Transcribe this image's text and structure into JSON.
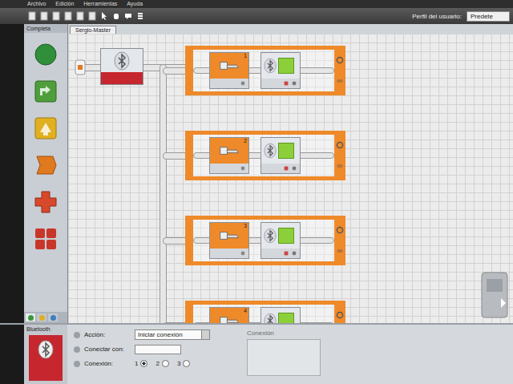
{
  "menu": [
    "Archivo",
    "Edición",
    "Herramientas",
    "Ayuda"
  ],
  "profile": {
    "label": "Perfil del usuario:",
    "value": "Predete"
  },
  "palette": {
    "title": "Completa",
    "items": [
      {
        "kind": "circle",
        "color": "#2f8f3a"
      },
      {
        "kind": "up-box",
        "color": "#4f9e3c"
      },
      {
        "kind": "arrow-box",
        "color": "#e0b020"
      },
      {
        "kind": "flag",
        "color": "#e07a1e"
      },
      {
        "kind": "plus",
        "color": "#d8482a"
      },
      {
        "kind": "grid",
        "color": "#c8362a"
      }
    ],
    "tabs": [
      {
        "color": "#3a9a3a",
        "selected": true
      },
      {
        "color": "#e0b020",
        "selected": false
      },
      {
        "color": "#3d7fbf",
        "selected": false
      }
    ]
  },
  "tabs": [
    {
      "label": "Sergio-Master",
      "selected": true
    }
  ],
  "loops": [
    {
      "sensor": "1"
    },
    {
      "sensor": "2"
    },
    {
      "sensor": "3"
    },
    {
      "sensor": "4"
    }
  ],
  "config": {
    "title": "Bluetooth",
    "action": {
      "label": "Acción:",
      "value": "Iniciar conexión"
    },
    "connect": {
      "label": "Conectar con:",
      "value": ""
    },
    "connection": {
      "label": "Conexión:",
      "options": [
        {
          "label": "1",
          "selected": true
        },
        {
          "label": "2",
          "selected": false
        },
        {
          "label": "3",
          "selected": false
        }
      ]
    },
    "side_label": "Conexión"
  }
}
